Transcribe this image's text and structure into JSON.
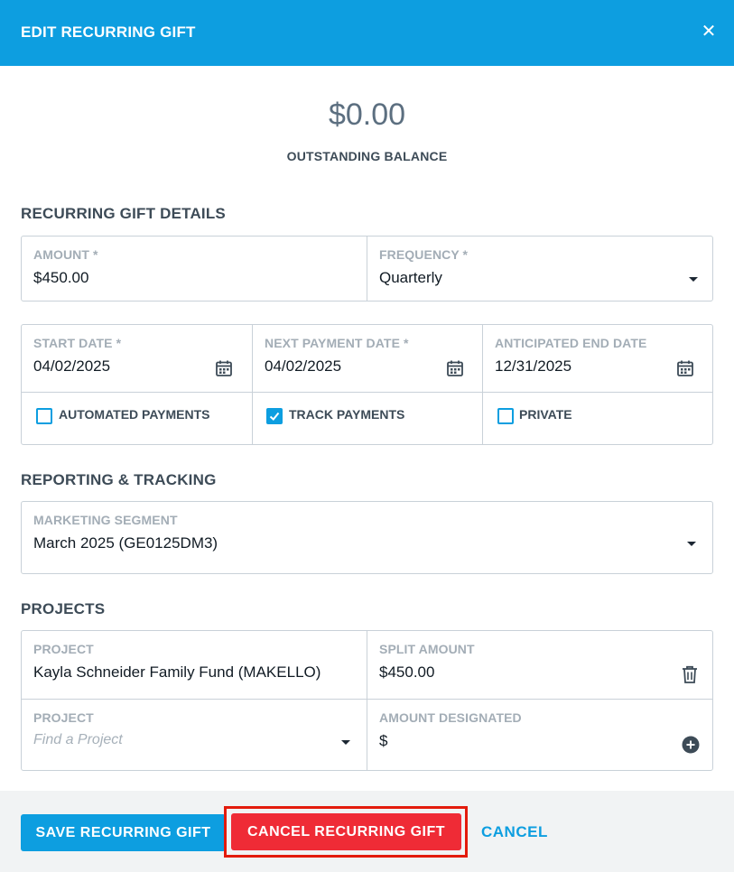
{
  "header": {
    "title": "EDIT RECURRING GIFT",
    "close_glyph": "✕"
  },
  "balance": {
    "amount": "$0.00",
    "label": "OUTSTANDING BALANCE"
  },
  "details": {
    "title": "RECURRING GIFT DETAILS",
    "amount": {
      "label": "AMOUNT  *",
      "value": "$450.00"
    },
    "frequency": {
      "label": "FREQUENCY *",
      "value": "Quarterly"
    },
    "start_date": {
      "label": "START DATE *",
      "value": "04/02/2025"
    },
    "next_payment_date": {
      "label": "NEXT PAYMENT DATE *",
      "value": "04/02/2025"
    },
    "end_date": {
      "label": "ANTICIPATED END DATE",
      "value": "12/31/2025"
    },
    "checkboxes": [
      {
        "label": "AUTOMATED PAYMENTS",
        "checked": false
      },
      {
        "label": "TRACK PAYMENTS",
        "checked": true
      },
      {
        "label": "PRIVATE",
        "checked": false
      }
    ]
  },
  "reporting": {
    "title": "REPORTING & TRACKING",
    "marketing_segment": {
      "label": "MARKETING SEGMENT",
      "value": "March 2025 (GE0125DM3)"
    }
  },
  "projects": {
    "title": "PROJECTS",
    "rows": [
      {
        "project_label": "PROJECT",
        "project_value": "Kayla Schneider Family Fund (MAKELLO)",
        "amount_label": "SPLIT AMOUNT",
        "amount_value": "$450.00"
      }
    ],
    "new_row": {
      "project_label": "PROJECT",
      "project_placeholder": "Find a Project",
      "amount_label": "AMOUNT DESIGNATED",
      "amount_value": "$"
    }
  },
  "footer": {
    "save_label": "SAVE RECURRING GIFT",
    "cancel_gift_label": "CANCEL RECURRING GIFT",
    "cancel_label": "CANCEL"
  },
  "colors": {
    "primary": "#0d9ee0",
    "danger": "#ef2b36",
    "highlight": "#e31b0c"
  }
}
